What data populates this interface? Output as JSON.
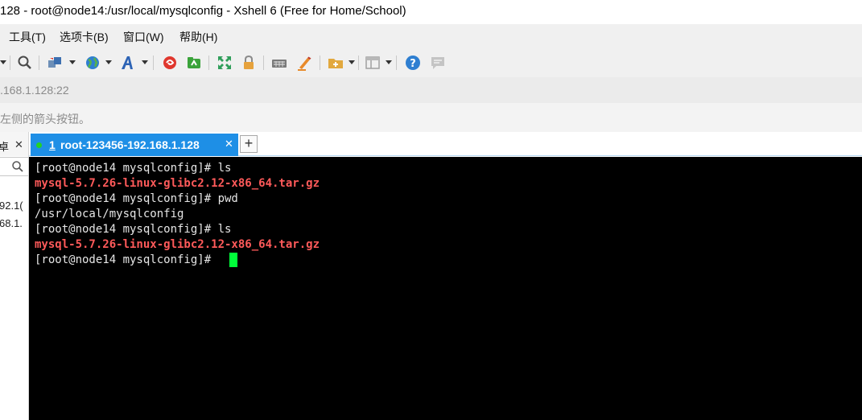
{
  "window": {
    "title": "128 - root@node14:/usr/local/mysqlconfig - Xshell 6 (Free for Home/School)"
  },
  "menu": {
    "items": [
      "工具(T)",
      "选项卡(B)",
      "窗口(W)",
      "帮助(H)"
    ]
  },
  "toolbar": {
    "icons": [
      "find-icon",
      "transfer-icon",
      "globe-icon",
      "font-icon",
      "xshell-icon",
      "xftp-icon",
      "fullscreen-icon",
      "lock-icon",
      "keyboard-icon",
      "highlight-icon",
      "new-folder-icon",
      "layout-icon",
      "help-icon",
      "chat-icon"
    ]
  },
  "address": {
    "value": ".168.1.128:22"
  },
  "hint": {
    "text": "左侧的箭头按钮。"
  },
  "side_panel": {
    "title": "卓",
    "close": "✕",
    "sessions": [
      "92.1(",
      "68.1."
    ]
  },
  "tabs": {
    "active": {
      "number": "1",
      "label": "root-123456-192.168.1.128",
      "close": "✕"
    },
    "add_label": "+"
  },
  "terminal": {
    "lines": [
      {
        "text": "[root@node14 mysqlconfig]# ls",
        "kind": "prompt"
      },
      {
        "text": "mysql-5.7.26-linux-glibc2.12-x86_64.tar.gz",
        "kind": "file"
      },
      {
        "text": "[root@node14 mysqlconfig]# pwd",
        "kind": "prompt"
      },
      {
        "text": "/usr/local/mysqlconfig",
        "kind": "output"
      },
      {
        "text": "[root@node14 mysqlconfig]# ls",
        "kind": "prompt"
      },
      {
        "text": "mysql-5.7.26-linux-glibc2.12-x86_64.tar.gz",
        "kind": "file"
      },
      {
        "text": "[root@node14 mysqlconfig]# ",
        "kind": "prompt"
      }
    ],
    "colors": {
      "background": "#000000",
      "text": "#e6e6e6",
      "archive": "#ff5a5a",
      "cursor": "#00ff3a"
    }
  },
  "colors": {
    "tab_active": "#1e8fe6",
    "session_connected": "#23d323"
  }
}
